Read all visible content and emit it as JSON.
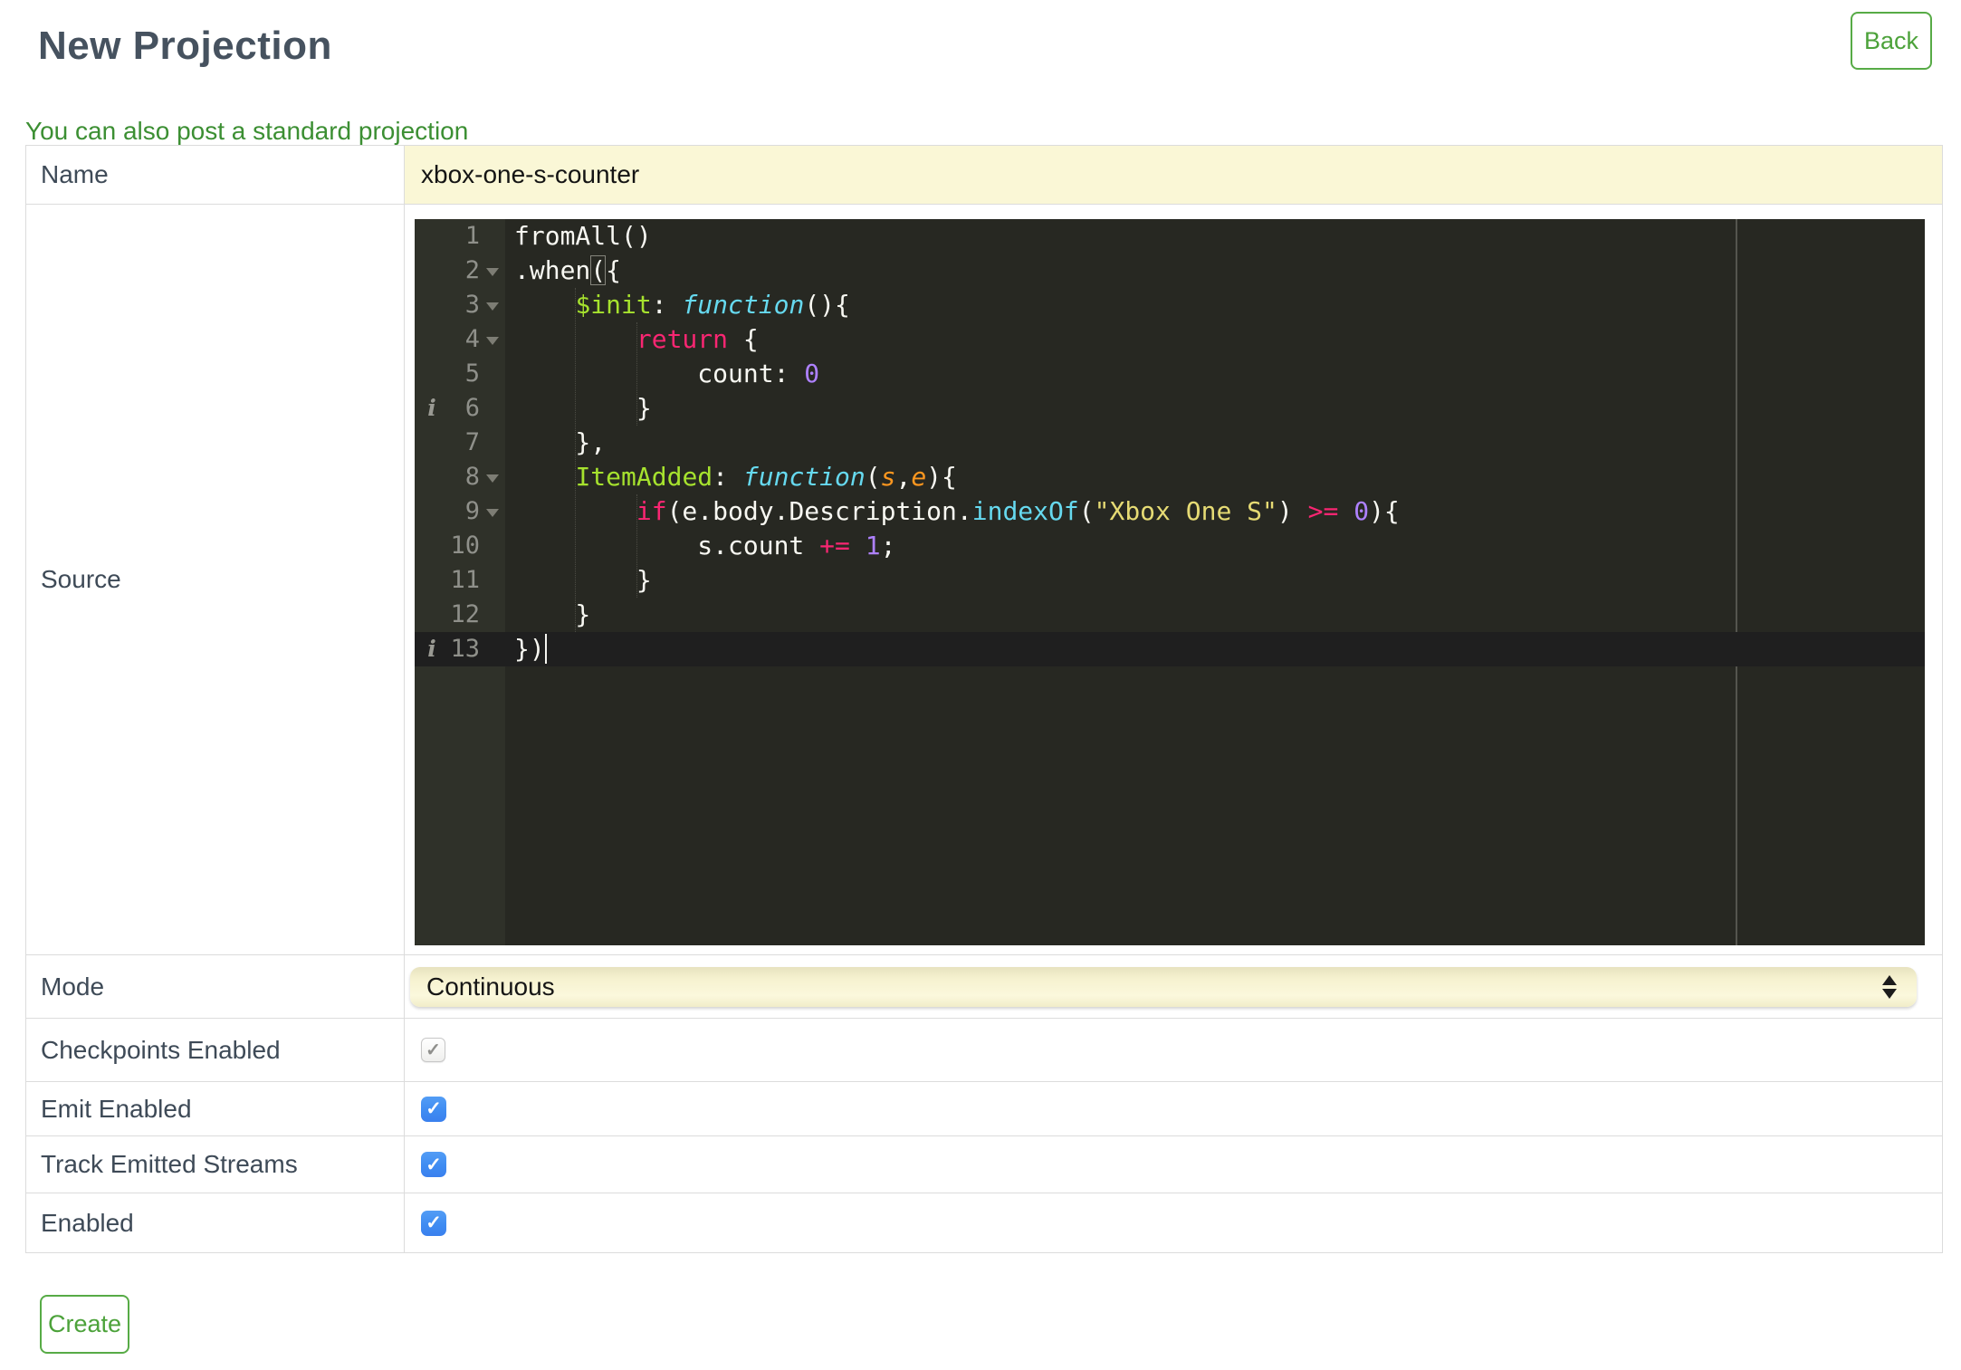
{
  "page": {
    "title": "New Projection",
    "back_label": "Back",
    "link_text": "You can also post a standard projection",
    "create_label": "Create"
  },
  "fields": {
    "name": {
      "label": "Name",
      "value": "xbox-one-s-counter"
    },
    "source": {
      "label": "Source"
    },
    "mode": {
      "label": "Mode",
      "value": "Continuous"
    },
    "checkpoints": {
      "label": "Checkpoints Enabled",
      "checked": true,
      "disabled": true
    },
    "emit": {
      "label": "Emit Enabled",
      "checked": true
    },
    "track": {
      "label": "Track Emitted Streams",
      "checked": true
    },
    "enabled": {
      "label": "Enabled",
      "checked": true
    }
  },
  "icons": {
    "checkmark": "✓"
  },
  "theme": {
    "page-bg": "#ffffff",
    "title-color": "#46525f",
    "label-color": "#3e4a57",
    "accent-green": "#57ab46",
    "green-text": "#4ca23a",
    "link-green": "#3c8f33",
    "row-border": "#dcdcdc",
    "cell-yellow": "#faf7d6",
    "checkbox-blue": "#3f8cf2"
  },
  "editor": {
    "active_line": 13,
    "print_margin_column": 80,
    "icons": {
      "info": "i"
    },
    "colors": {
      "ed-bg": "#272822",
      "ed-gutter": "#2f3129",
      "ed-text": "#f8f8f2",
      "ed-linenum": "#8f908a",
      "ed-active": "#1f1f1f",
      "ed-keyword": "#f92672",
      "ed-entity": "#a6e22e",
      "ed-storage": "#66d9ef",
      "ed-support": "#66d9ef",
      "ed-string": "#e6db74",
      "ed-number": "#ae81ff",
      "ed-param": "#fd971f",
      "ed-guide": "#4c4c44",
      "ed-margin-line": "#55554e"
    },
    "lines": [
      {
        "n": 1,
        "tokens": [
          {
            "t": "fromAll()",
            "c": "plain"
          }
        ]
      },
      {
        "n": 2,
        "fold": true,
        "tokens": [
          {
            "t": ".when",
            "c": "plain"
          },
          {
            "t": "(",
            "c": "plain",
            "bracket": true
          },
          {
            "t": "{",
            "c": "plain"
          }
        ]
      },
      {
        "n": 3,
        "fold": true,
        "tokens": [
          {
            "t": "    ",
            "c": "plain"
          },
          {
            "t": "$init",
            "c": "entity"
          },
          {
            "t": ": ",
            "c": "plain"
          },
          {
            "t": "function",
            "c": "storage"
          },
          {
            "t": "(){",
            "c": "plain"
          }
        ]
      },
      {
        "n": 4,
        "fold": true,
        "tokens": [
          {
            "t": "        ",
            "c": "plain"
          },
          {
            "t": "return",
            "c": "keyword"
          },
          {
            "t": " {",
            "c": "plain"
          }
        ]
      },
      {
        "n": 5,
        "tokens": [
          {
            "t": "            count: ",
            "c": "plain"
          },
          {
            "t": "0",
            "c": "number"
          }
        ]
      },
      {
        "n": 6,
        "info": true,
        "tokens": [
          {
            "t": "        }",
            "c": "plain"
          }
        ]
      },
      {
        "n": 7,
        "tokens": [
          {
            "t": "    },",
            "c": "plain"
          }
        ]
      },
      {
        "n": 8,
        "fold": true,
        "tokens": [
          {
            "t": "    ",
            "c": "plain"
          },
          {
            "t": "ItemAdded",
            "c": "entity"
          },
          {
            "t": ": ",
            "c": "plain"
          },
          {
            "t": "function",
            "c": "storage"
          },
          {
            "t": "(",
            "c": "plain"
          },
          {
            "t": "s",
            "c": "param"
          },
          {
            "t": ",",
            "c": "plain"
          },
          {
            "t": "e",
            "c": "param"
          },
          {
            "t": "){",
            "c": "plain"
          }
        ]
      },
      {
        "n": 9,
        "fold": true,
        "tokens": [
          {
            "t": "        ",
            "c": "plain"
          },
          {
            "t": "if",
            "c": "keyword"
          },
          {
            "t": "(e.body.Description.",
            "c": "plain"
          },
          {
            "t": "indexOf",
            "c": "support"
          },
          {
            "t": "(",
            "c": "plain"
          },
          {
            "t": "\"Xbox One S\"",
            "c": "string"
          },
          {
            "t": ") ",
            "c": "plain"
          },
          {
            "t": ">=",
            "c": "keyword"
          },
          {
            "t": " ",
            "c": "plain"
          },
          {
            "t": "0",
            "c": "number"
          },
          {
            "t": "){",
            "c": "plain"
          }
        ]
      },
      {
        "n": 10,
        "tokens": [
          {
            "t": "            s.count ",
            "c": "plain"
          },
          {
            "t": "+=",
            "c": "keyword"
          },
          {
            "t": " ",
            "c": "plain"
          },
          {
            "t": "1",
            "c": "number"
          },
          {
            "t": ";",
            "c": "plain"
          }
        ]
      },
      {
        "n": 11,
        "tokens": [
          {
            "t": "        }",
            "c": "plain"
          }
        ]
      },
      {
        "n": 12,
        "tokens": [
          {
            "t": "    }",
            "c": "plain"
          }
        ]
      },
      {
        "n": 13,
        "info": true,
        "cursor": true,
        "tokens": [
          {
            "t": "})",
            "c": "plain"
          }
        ]
      }
    ]
  }
}
